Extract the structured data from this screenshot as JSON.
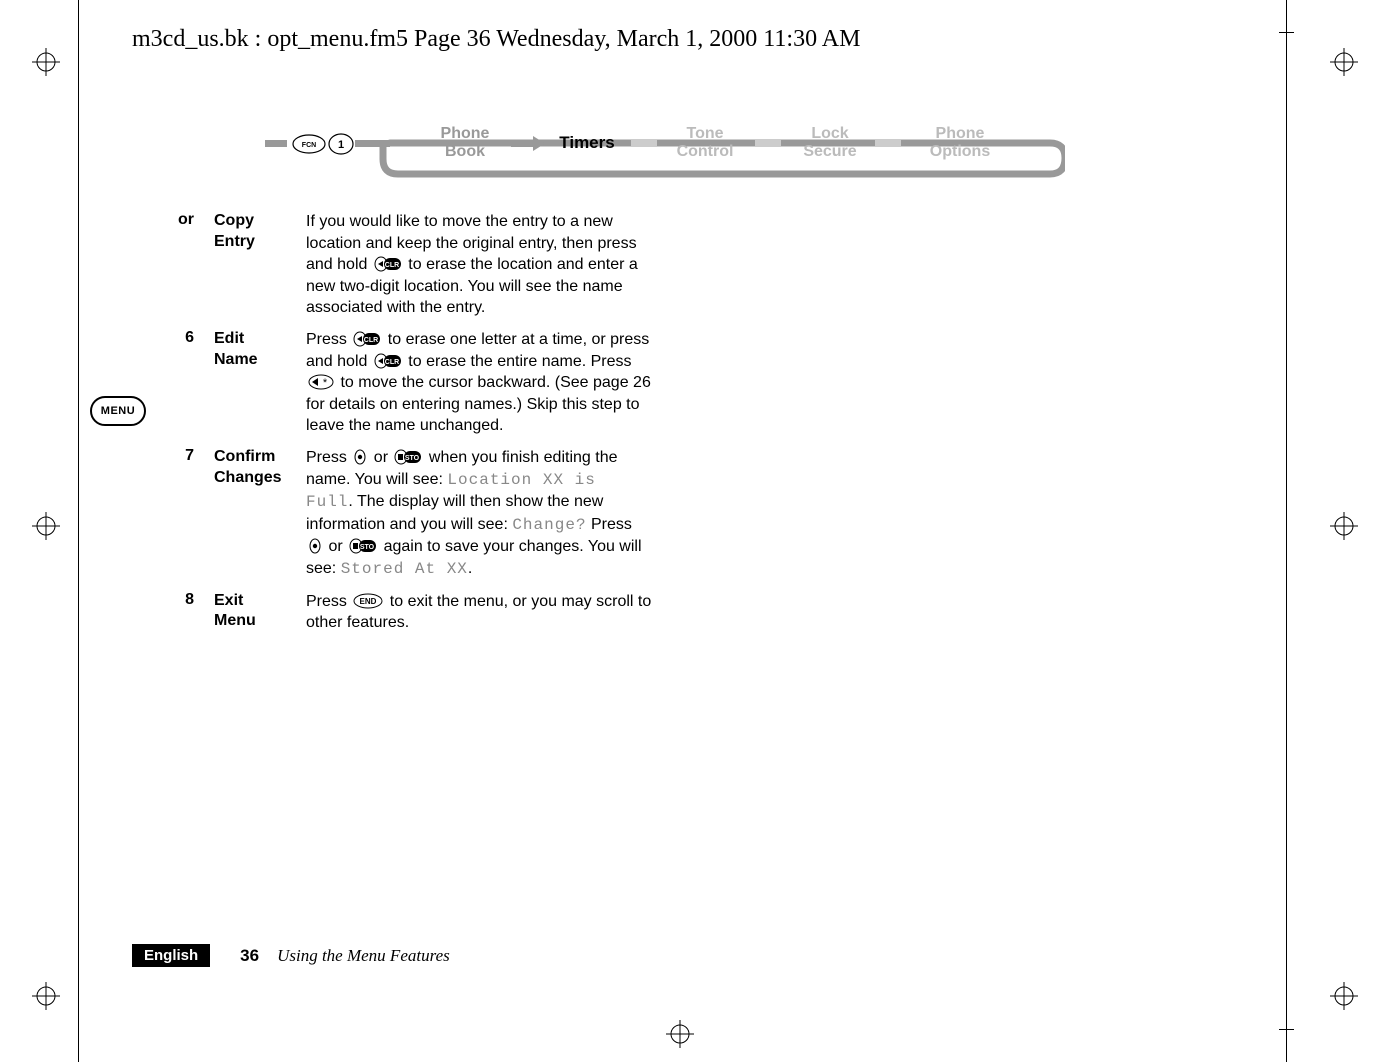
{
  "header": "m3cd_us.bk : opt_menu.fm5  Page 36  Wednesday, March 1, 2000  11:30 AM",
  "ribbon": {
    "items": [
      "Phone Book",
      "Timers",
      "Tone Control",
      "Lock Secure",
      "Phone Options"
    ],
    "active_index": 1
  },
  "menu_badge": "MENU",
  "steps": [
    {
      "num": "or",
      "label": "Copy Entry",
      "body_parts": [
        {
          "t": "text",
          "v": "If you would like to move the entry to a new location and keep the original entry, then press and hold "
        },
        {
          "t": "key",
          "v": "clr"
        },
        {
          "t": "text",
          "v": " to erase the location and enter a new two-digit location. You will see the name associated with the entry."
        }
      ]
    },
    {
      "num": "6",
      "label": "Edit Name",
      "body_parts": [
        {
          "t": "text",
          "v": "Press "
        },
        {
          "t": "key",
          "v": "clr"
        },
        {
          "t": "text",
          "v": " to erase one letter at a time, or press and hold "
        },
        {
          "t": "key",
          "v": "clr"
        },
        {
          "t": "text",
          "v": " to erase the entire name. Press "
        },
        {
          "t": "key",
          "v": "left-star"
        },
        {
          "t": "text",
          "v": " to move the cursor backward. (See page 26 for details on entering names.) Skip this step to leave the name unchanged."
        }
      ]
    },
    {
      "num": "7",
      "label": "Confirm Changes",
      "body_parts": [
        {
          "t": "text",
          "v": "Press "
        },
        {
          "t": "key",
          "v": "dot"
        },
        {
          "t": "text",
          "v": " or "
        },
        {
          "t": "key",
          "v": "sto"
        },
        {
          "t": "text",
          "v": " when you finish editing the name. You will see: "
        },
        {
          "t": "mono",
          "v": "Location XX is Full"
        },
        {
          "t": "text",
          "v": ". The display will then show the new information and you will see: "
        },
        {
          "t": "mono",
          "v": "Change?"
        },
        {
          "t": "text",
          "v": " Press "
        },
        {
          "t": "key",
          "v": "dot"
        },
        {
          "t": "text",
          "v": " or "
        },
        {
          "t": "key",
          "v": "sto"
        },
        {
          "t": "text",
          "v": " again to save your changes. You will see: "
        },
        {
          "t": "mono",
          "v": "Stored At XX"
        },
        {
          "t": "text",
          "v": "."
        }
      ]
    },
    {
      "num": "8",
      "label": "Exit Menu",
      "body_parts": [
        {
          "t": "text",
          "v": "Press "
        },
        {
          "t": "key",
          "v": "end"
        },
        {
          "t": "text",
          "v": " to exit the menu, or you may scroll to other features."
        }
      ]
    }
  ],
  "footer": {
    "language": "English",
    "page": "36",
    "section": "Using the Menu Features"
  }
}
